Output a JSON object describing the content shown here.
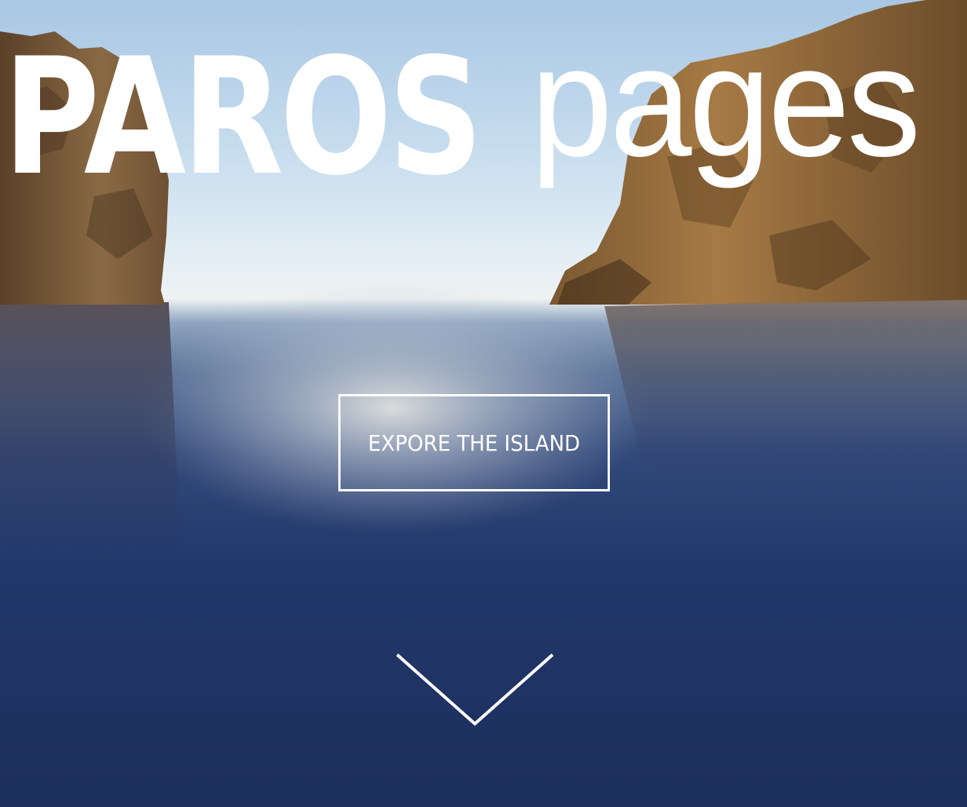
{
  "brand": {
    "logo_bold": "PAROS",
    "logo_light": "pages"
  },
  "hero": {
    "cta_label": "EXPORE THE ISLAND",
    "scroll_icon": "chevron-down-icon"
  },
  "colors": {
    "text": "#ffffff",
    "sea_deep": "#1c2f5e",
    "sky": "#a9c7e3",
    "rock": "#8a6a42"
  }
}
